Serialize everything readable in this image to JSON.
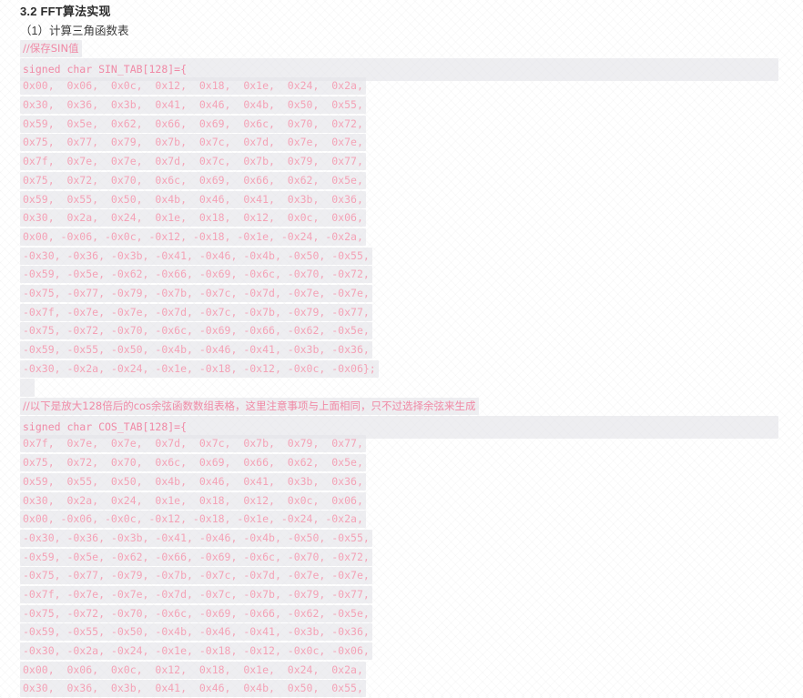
{
  "document": {
    "title": "3.2 FFT算法实现",
    "subtitle": "（1）计算三角函数表"
  },
  "colors": {
    "code_text": "#f4a0b5",
    "highlight_bg": "#e4e4e8",
    "title_text": "#2b2b2b",
    "page_bg": "#ffffff"
  },
  "code": {
    "lines": [
      {
        "kind": "comment",
        "text": "//保存SIN值"
      },
      {
        "kind": "decl",
        "text": "signed char SIN_TAB[128]={"
      },
      {
        "kind": "data",
        "text": "0x00,  0x06,  0x0c,  0x12,  0x18,  0x1e,  0x24,  0x2a,"
      },
      {
        "kind": "data",
        "text": "0x30,  0x36,  0x3b,  0x41,  0x46,  0x4b,  0x50,  0x55,"
      },
      {
        "kind": "data",
        "text": "0x59,  0x5e,  0x62,  0x66,  0x69,  0x6c,  0x70,  0x72,"
      },
      {
        "kind": "data",
        "text": "0x75,  0x77,  0x79,  0x7b,  0x7c,  0x7d,  0x7e,  0x7e,"
      },
      {
        "kind": "data",
        "text": "0x7f,  0x7e,  0x7e,  0x7d,  0x7c,  0x7b,  0x79,  0x77,"
      },
      {
        "kind": "data",
        "text": "0x75,  0x72,  0x70,  0x6c,  0x69,  0x66,  0x62,  0x5e,"
      },
      {
        "kind": "data",
        "text": "0x59,  0x55,  0x50,  0x4b,  0x46,  0x41,  0x3b,  0x36,"
      },
      {
        "kind": "data",
        "text": "0x30,  0x2a,  0x24,  0x1e,  0x18,  0x12,  0x0c,  0x06,"
      },
      {
        "kind": "data",
        "text": "0x00, -0x06, -0x0c, -0x12, -0x18, -0x1e, -0x24, -0x2a,"
      },
      {
        "kind": "data",
        "text": "-0x30, -0x36, -0x3b, -0x41, -0x46, -0x4b, -0x50, -0x55,"
      },
      {
        "kind": "data",
        "text": "-0x59, -0x5e, -0x62, -0x66, -0x69, -0x6c, -0x70, -0x72,"
      },
      {
        "kind": "data",
        "text": "-0x75, -0x77, -0x79, -0x7b, -0x7c, -0x7d, -0x7e, -0x7e,"
      },
      {
        "kind": "data",
        "text": "-0x7f, -0x7e, -0x7e, -0x7d, -0x7c, -0x7b, -0x79, -0x77,"
      },
      {
        "kind": "data",
        "text": "-0x75, -0x72, -0x70, -0x6c, -0x69, -0x66, -0x62, -0x5e,"
      },
      {
        "kind": "data",
        "text": "-0x59, -0x55, -0x50, -0x4b, -0x46, -0x41, -0x3b, -0x36,"
      },
      {
        "kind": "data",
        "text": "-0x30, -0x2a, -0x24, -0x1e, -0x18, -0x12, -0x0c, -0x06};"
      },
      {
        "kind": "blank",
        "text": ""
      },
      {
        "kind": "comment",
        "text": "//以下是放大128倍后的cos余弦函数数组表格，这里注意事项与上面相同，只不过选择余弦来生成"
      },
      {
        "kind": "decl",
        "text": "signed char COS_TAB[128]={"
      },
      {
        "kind": "data",
        "text": "0x7f,  0x7e,  0x7e,  0x7d,  0x7c,  0x7b,  0x79,  0x77,"
      },
      {
        "kind": "data",
        "text": "0x75,  0x72,  0x70,  0x6c,  0x69,  0x66,  0x62,  0x5e,"
      },
      {
        "kind": "data",
        "text": "0x59,  0x55,  0x50,  0x4b,  0x46,  0x41,  0x3b,  0x36,"
      },
      {
        "kind": "data",
        "text": "0x30,  0x2a,  0x24,  0x1e,  0x18,  0x12,  0x0c,  0x06,"
      },
      {
        "kind": "data",
        "text": "0x00, -0x06, -0x0c, -0x12, -0x18, -0x1e, -0x24, -0x2a,"
      },
      {
        "kind": "data",
        "text": "-0x30, -0x36, -0x3b, -0x41, -0x46, -0x4b, -0x50, -0x55,"
      },
      {
        "kind": "data",
        "text": "-0x59, -0x5e, -0x62, -0x66, -0x69, -0x6c, -0x70, -0x72,"
      },
      {
        "kind": "data",
        "text": "-0x75, -0x77, -0x79, -0x7b, -0x7c, -0x7d, -0x7e, -0x7e,"
      },
      {
        "kind": "data",
        "text": "-0x7f, -0x7e, -0x7e, -0x7d, -0x7c, -0x7b, -0x79, -0x77,"
      },
      {
        "kind": "data",
        "text": "-0x75, -0x72, -0x70, -0x6c, -0x69, -0x66, -0x62, -0x5e,"
      },
      {
        "kind": "data",
        "text": "-0x59, -0x55, -0x50, -0x4b, -0x46, -0x41, -0x3b, -0x36,"
      },
      {
        "kind": "data",
        "text": "-0x30, -0x2a, -0x24, -0x1e, -0x18, -0x12, -0x0c, -0x06,"
      },
      {
        "kind": "data",
        "text": "0x00,  0x06,  0x0c,  0x12,  0x18,  0x1e,  0x24,  0x2a,"
      },
      {
        "kind": "data",
        "text": "0x30,  0x36,  0x3b,  0x41,  0x46,  0x4b,  0x50,  0x55,"
      }
    ]
  }
}
